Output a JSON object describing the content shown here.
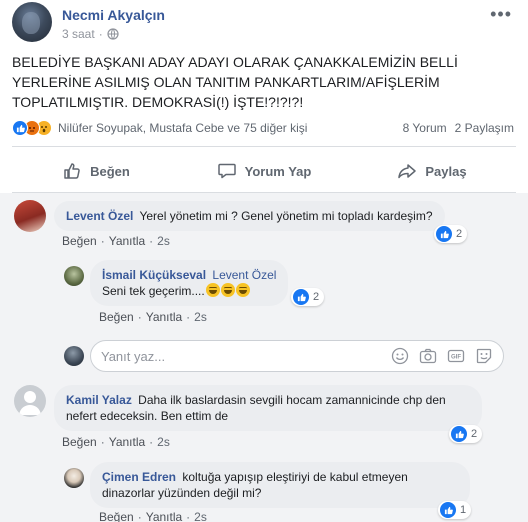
{
  "post": {
    "author": "Necmi Akyalçın",
    "time": "3 saat",
    "more_icon": "more-dots-icon",
    "text": "BELEDİYE BAŞKANI ADAY ADAYI OLARAK ÇANAKKALEMİZİN BELLİ\nYERLERİNE ASILMIŞ OLAN TANITIM PANKARTLARIM/AFİŞLERİM\nTOPLATILMIŞTIR. DEMOKRASİ(!) İŞTE!?!?!?!",
    "reactors": "Nilüfer Soyupak, Mustafa Cebe ve 75 diğer kişi",
    "comment_count": "8 Yorum",
    "share_count": "2 Paylaşım"
  },
  "actions": {
    "like": "Beğen",
    "comment": "Yorum Yap",
    "share": "Paylaş"
  },
  "comments": [
    {
      "author": "Levent Özel",
      "text": "Yerel yönetim mi ? Genel yönetim mi topladı kardeşim?",
      "like": "Beğen",
      "reply": "Yanıtla",
      "time": "2s",
      "likes": "2"
    },
    {
      "author": "İsmail Küçükseval",
      "tag": "Levent Özel",
      "text": "Seni tek geçerim....",
      "like": "Beğen",
      "reply": "Yanıtla",
      "time": "2s",
      "likes": "2"
    },
    {
      "author": "Kamil Yalaz",
      "text": "Daha ilk baslardasin sevgili hocam zamannicinde chp den nefert edeceksin. Ben ettim de",
      "like": "Beğen",
      "reply": "Yanıtla",
      "time": "2s",
      "likes": "2"
    },
    {
      "author": "Çimen Edren",
      "text": "koltuğa yapışıp eleştiriyi de kabul etmeyen dinazorlar yüzünden değil mi?",
      "like": "Beğen",
      "reply": "Yanıtla",
      "time": "2s",
      "likes": "1"
    }
  ],
  "reply_box": {
    "placeholder": "Yanıt yaz..."
  },
  "colors": {
    "link_blue": "#385898",
    "like_blue": "#1877f2",
    "comment_bg": "#f2f3f5",
    "bubble_bg": "#ebedf0"
  }
}
